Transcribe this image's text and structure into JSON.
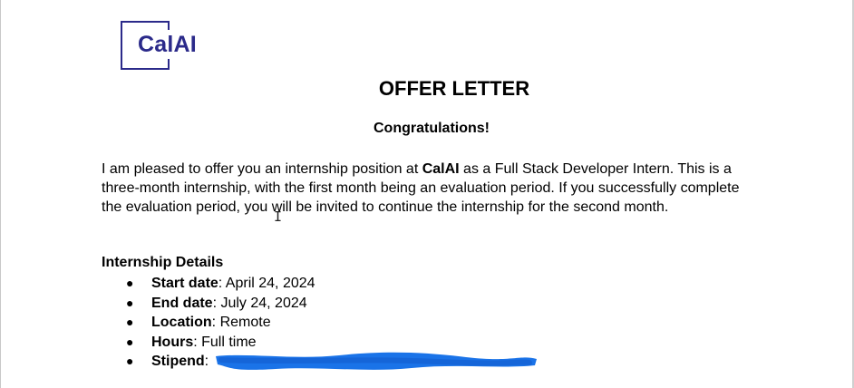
{
  "logo": {
    "text": "CalAI",
    "color": "#2b2a8a"
  },
  "title": "OFFER LETTER",
  "subtitle": "Congratulations!",
  "intro": {
    "before": "I am pleased to offer you an internship position at ",
    "company": "CalAI",
    "after": " as a Full Stack Developer Intern. This is a three-month internship, with the first month being an evaluation period. If you successfully complete the evaluation period, you will be invited to continue the internship for the second month."
  },
  "details": {
    "heading": "Internship Details",
    "items": [
      {
        "label": "Start date",
        "value": ": April 24, 2024"
      },
      {
        "label": "End date",
        "value": ": July 24, 2024"
      },
      {
        "label": "Location",
        "value": ": Remote"
      },
      {
        "label": "Hours",
        "value": ": Full time"
      },
      {
        "label": "Stipend",
        "value": ": "
      }
    ],
    "bullet": "●"
  },
  "redaction_color": "#1a73e8",
  "cursor_glyph": "I"
}
